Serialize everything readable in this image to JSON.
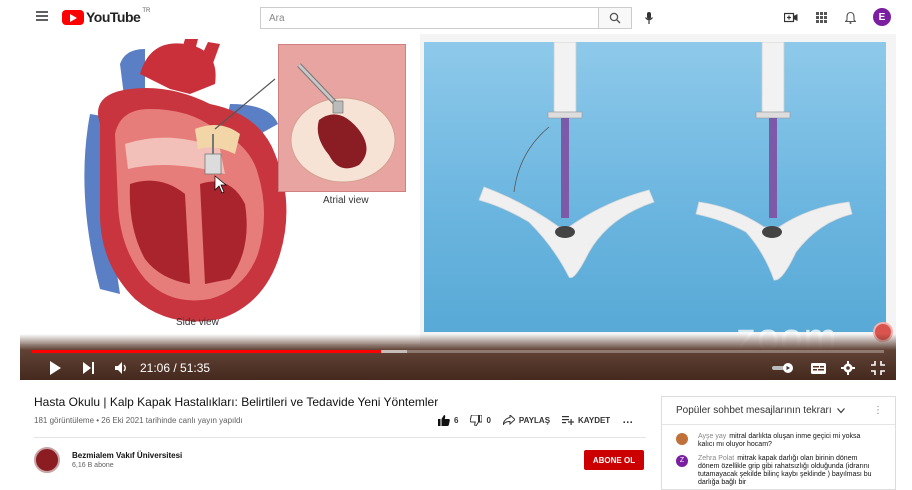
{
  "header": {
    "logo_text": "YouTube",
    "logo_region": "TR",
    "search_placeholder": "Ara",
    "avatar_letter": "E"
  },
  "video": {
    "caption_side": "Side view",
    "caption_atrial": "Atrial view",
    "watermark": "zoom",
    "time_display": "21:06 / 51:35",
    "progress": 0.41,
    "buffered": 0.44
  },
  "info": {
    "title": "Hasta Okulu | Kalp Kapak Hastalıkları: Belirtileri ve Tedavide Yeni Yöntemler",
    "meta": "181 görüntüleme • 26 Eki 2021 tarihinde canlı yayın yapıldı",
    "likes": "6",
    "dislikes": "0",
    "share_label": "PAYLAŞ",
    "save_label": "KAYDET",
    "more_label": "…"
  },
  "channel": {
    "name": "Bezmialem Vakıf Üniversitesi",
    "subscribers": "6,16 B abone",
    "subscribe_label": "ABONE OL"
  },
  "chat": {
    "header": "Popüler sohbet mesajlarının tekrarı",
    "messages": [
      {
        "author": "Ayşe yay",
        "text": "mitral darlıkta oluşan inme geçici mi yoksa kalıcı mı oluyor hocam?",
        "avatar_color": "#c0713a",
        "avatar_letter": ""
      },
      {
        "author": "Zehra Polat",
        "text": "mitrak kapak darlığı olan birinin dönem dönem özellikle grip gibi rahatsızlığı olduğunda (idrarını tutamayacak şekilde bilinç kaybı şeklinde ) bayılması bu darlığa bağlı bir",
        "avatar_color": "#7b1fa2",
        "avatar_letter": "Z"
      }
    ]
  }
}
